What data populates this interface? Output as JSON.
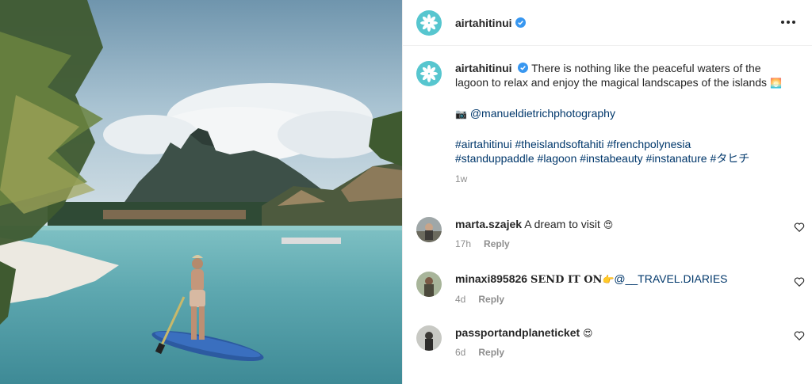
{
  "post": {
    "author": "airtahitinui",
    "caption_text": "There is nothing like the peaceful waters of the lagoon to relax and enjoy the magical landscapes of the islands",
    "caption_emoji": "🌅",
    "photo_icon": "📷",
    "photo_credit": "@manueldietrichphotography",
    "hashtags_line1": "#airtahitinui #theislandsoftahiti #frenchpolynesia",
    "hashtags_line2": "#standuppaddle #lagoon #instabeauty #instanature #タヒチ",
    "age": "1w"
  },
  "comments": [
    {
      "user": "marta.szajek",
      "text": "A dream to visit",
      "emoji": "😍",
      "age": "17h",
      "reply": "Reply"
    },
    {
      "user": "minaxi895826",
      "text_bold": "SEND IT ON",
      "emoji": "👉",
      "text_link": "@__TRAVEL.DIARIES",
      "age": "4d",
      "reply": "Reply"
    },
    {
      "user": "passportandplaneticket",
      "text": "",
      "emoji": "😍",
      "age": "6d",
      "reply": "Reply"
    }
  ],
  "colors": {
    "brand": "#57c6cf",
    "verified": "#3897f0",
    "link": "#00376b",
    "muted": "#8e8e8e"
  },
  "icons": [
    "flower-logo-icon",
    "verified-badge-icon",
    "more-options-icon",
    "heart-icon",
    "camera-icon"
  ]
}
